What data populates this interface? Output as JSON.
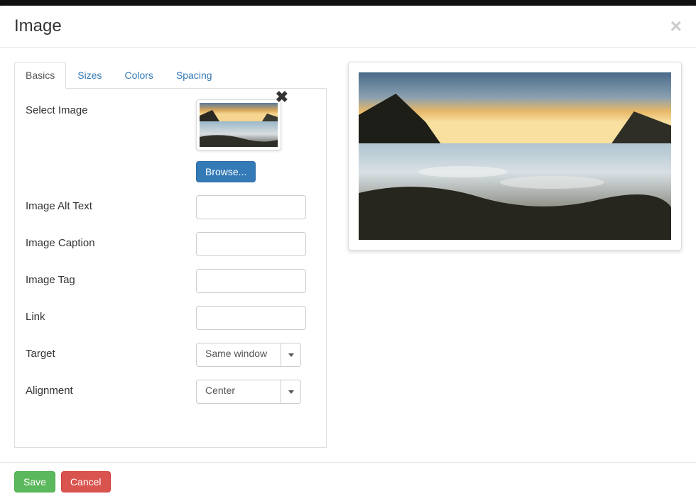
{
  "modal": {
    "title": "Image"
  },
  "tabs": [
    {
      "label": "Basics",
      "active": true
    },
    {
      "label": "Sizes",
      "active": false
    },
    {
      "label": "Colors",
      "active": false
    },
    {
      "label": "Spacing",
      "active": false
    }
  ],
  "fields": {
    "select_image": {
      "label": "Select Image",
      "browse_label": "Browse..."
    },
    "alt_text": {
      "label": "Image Alt Text",
      "value": ""
    },
    "caption": {
      "label": "Image Caption",
      "value": ""
    },
    "tag": {
      "label": "Image Tag",
      "value": ""
    },
    "link": {
      "label": "Link",
      "value": ""
    },
    "target": {
      "label": "Target",
      "value": "Same window"
    },
    "alignment": {
      "label": "Alignment",
      "value": "Center"
    }
  },
  "footer": {
    "save_label": "Save",
    "cancel_label": "Cancel"
  }
}
